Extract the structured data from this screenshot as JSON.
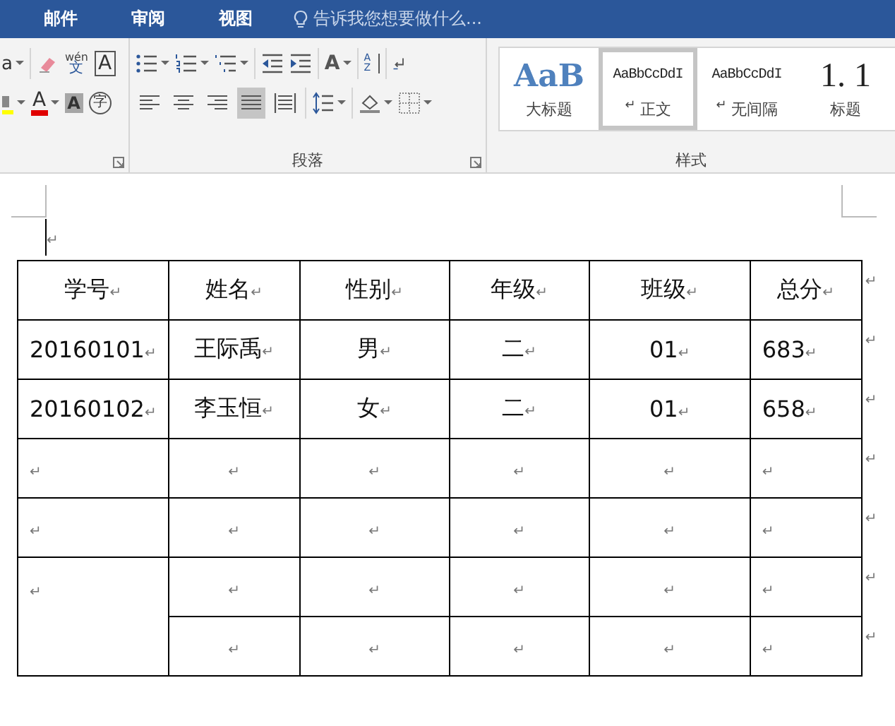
{
  "menu_tabs": [
    {
      "label": "邮件",
      "selected": false
    },
    {
      "label": "审阅",
      "selected": false
    },
    {
      "label": "视图",
      "selected": false
    }
  ],
  "tell_me": {
    "placeholder": "告诉我您想要做什么..."
  },
  "ribbon": {
    "font_group": {
      "font_name_cut": "a",
      "phonetic_guide": [
        "wén",
        "文"
      ],
      "char_border": "A",
      "font_color": "A",
      "char_shading": "A",
      "enclose_char": "字"
    },
    "paragraph": {
      "label": "段落",
      "change_case": "A",
      "sort": [
        "A",
        "Z"
      ],
      "align": [
        {
          "selected": false
        },
        {
          "selected": false
        },
        {
          "selected": false
        },
        {
          "selected": true
        },
        {
          "selected": false
        }
      ]
    },
    "styles": {
      "label": "样式",
      "items": [
        {
          "sample": "AaB",
          "name": "大标题",
          "kind": "title",
          "selected": false
        },
        {
          "sample": "AaBbCcDdI",
          "name": "正文",
          "mark": "↵",
          "kind": "body",
          "selected": true
        },
        {
          "sample": "AaBbCcDdI",
          "name": "无间隔",
          "mark": "↵",
          "kind": "body",
          "selected": false
        },
        {
          "sample": "1. 1",
          "name": "标题",
          "kind": "heading",
          "selected": false
        }
      ]
    }
  },
  "document": {
    "cursor_mark": "↵",
    "table": {
      "rows": [
        {
          "end_mark": "↵",
          "cells": [
            {
              "text": "学号",
              "mark": "↵"
            },
            {
              "text": "姓名",
              "mark": "↵"
            },
            {
              "text": "性别",
              "mark": "↵"
            },
            {
              "text": "年级",
              "mark": "↵"
            },
            {
              "text": "班级",
              "mark": "↵"
            },
            {
              "text": "总分",
              "mark": "↵"
            }
          ]
        },
        {
          "end_mark": "↵",
          "cells": [
            {
              "text": "20160101",
              "mark": "↵"
            },
            {
              "text": "王际禹",
              "mark": "↵"
            },
            {
              "text": "男",
              "mark": "↵"
            },
            {
              "text": "二",
              "mark": "↵"
            },
            {
              "text": "01",
              "mark": "↵"
            },
            {
              "text": "683",
              "mark": "↵"
            }
          ]
        },
        {
          "end_mark": "↵",
          "cells": [
            {
              "text": "20160102",
              "mark": "↵"
            },
            {
              "text": "李玉恒",
              "mark": "↵"
            },
            {
              "text": "女",
              "mark": "↵"
            },
            {
              "text": "二",
              "mark": "↵"
            },
            {
              "text": "01",
              "mark": "↵"
            },
            {
              "text": "658",
              "mark": "↵"
            }
          ]
        },
        {
          "end_mark": "↵",
          "cells": [
            {
              "mark": "↵"
            },
            {
              "mark": "↵"
            },
            {
              "mark": "↵"
            },
            {
              "mark": "↵"
            },
            {
              "mark": "↵"
            },
            {
              "mark": "↵"
            }
          ]
        },
        {
          "end_mark": "↵",
          "cells": [
            {
              "mark": "↵"
            },
            {
              "mark": "↵"
            },
            {
              "mark": "↵"
            },
            {
              "mark": "↵"
            },
            {
              "mark": "↵"
            },
            {
              "mark": "↵"
            }
          ]
        },
        {
          "end_mark": "↵",
          "cells": [
            {
              "mark": "↵",
              "rowspan": 2
            },
            {
              "mark": "↵"
            },
            {
              "mark": "↵"
            },
            {
              "mark": "↵"
            },
            {
              "mark": "↵"
            },
            {
              "mark": "↵"
            }
          ]
        },
        {
          "end_mark": "↵",
          "cells": [
            {
              "mark": "↵"
            },
            {
              "mark": "↵"
            },
            {
              "mark": "↵"
            },
            {
              "mark": "↵"
            },
            {
              "mark": "↵"
            }
          ]
        }
      ]
    }
  }
}
